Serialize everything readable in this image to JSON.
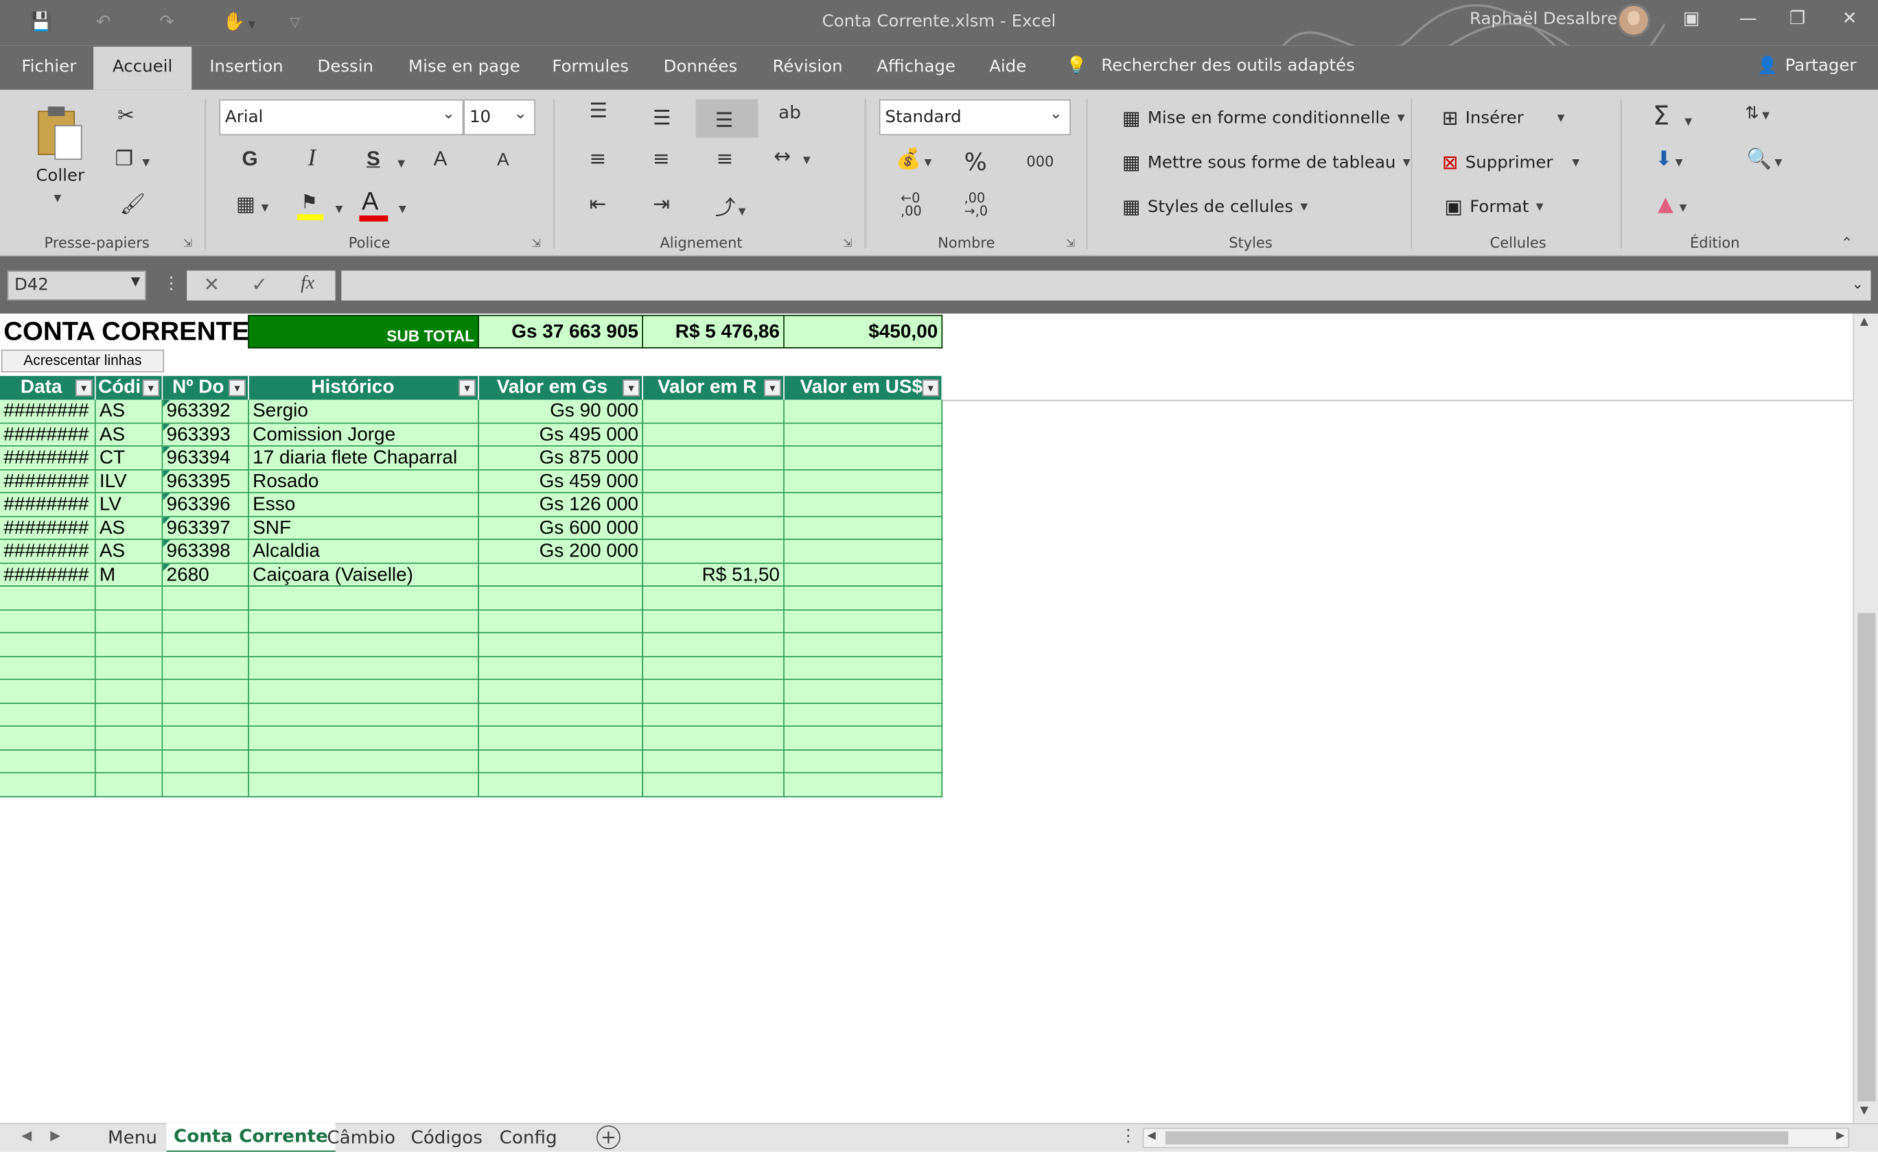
{
  "window": {
    "doc_title": "Conta Corrente.xlsm  -  Excel",
    "user_name": "Raphaël Desalbres"
  },
  "ribbon_tabs": [
    "Fichier",
    "Accueil",
    "Insertion",
    "Dessin",
    "Mise en page",
    "Formules",
    "Données",
    "Révision",
    "Affichage",
    "Aide"
  ],
  "ribbon_search": "Rechercher des outils adaptés",
  "share_label": "Partager",
  "groups": {
    "clipboard": "Presse-papiers",
    "font": "Police",
    "alignment": "Alignement",
    "number": "Nombre",
    "styles": "Styles",
    "cells": "Cellules",
    "editing": "Édition"
  },
  "clipboard": {
    "paste": "Coller"
  },
  "font": {
    "name": "Arial",
    "size": "10",
    "bold": "G",
    "italic": "I",
    "underline": "S",
    "grow": "A",
    "shrink": "A",
    "color": "A"
  },
  "number": {
    "format": "Standard",
    "percent": "%",
    "thousands": "000",
    "inc_dec_top": "←0",
    "inc_dec_bottom": ",00",
    "dec_dec_top": ",00",
    "dec_dec_bottom": "→,0"
  },
  "styles": {
    "conditional": "Mise en forme conditionnelle",
    "as_table": "Mettre sous forme de tableau",
    "cell_styles": "Styles de cellules"
  },
  "cells": {
    "insert": "Insérer",
    "delete": "Supprimer",
    "format": "Format"
  },
  "formula_bar": {
    "name_box": "D42",
    "fx": "fx",
    "value": ""
  },
  "sheet": {
    "title": "CONTA CORRENTE",
    "subtotal_label": "SUB TOTAL",
    "subtotal_gs": "Gs 37 663 905",
    "subtotal_rs": "R$ 5 476,86",
    "subtotal_usd": "$450,00",
    "add_rows_button": "Acrescentar  linhas",
    "headers": [
      "Data",
      "Códi",
      "Nº Do",
      "Histórico",
      "Valor em Gs",
      "Valor em R",
      "Valor em US$"
    ],
    "rows": [
      [
        "########",
        "AS",
        "963392",
        "Sergio",
        "Gs 90 000",
        "",
        ""
      ],
      [
        "########",
        "AS",
        "963393",
        "Comission Jorge",
        "Gs 495 000",
        "",
        ""
      ],
      [
        "########",
        "CT",
        "963394",
        "17 diaria flete Chaparral",
        "Gs 875 000",
        "",
        ""
      ],
      [
        "########",
        "ILV",
        "963395",
        "Rosado",
        "Gs 459 000",
        "",
        ""
      ],
      [
        "########",
        "LV",
        "963396",
        "Esso",
        "Gs 126 000",
        "",
        ""
      ],
      [
        "########",
        "AS",
        "963397",
        "SNF",
        "Gs 600 000",
        "",
        ""
      ],
      [
        "########",
        "AS",
        "963398",
        "Alcaldia",
        "Gs 200 000",
        "",
        ""
      ],
      [
        "########",
        "M",
        "2680",
        "Caiçoara (Vaiselle)",
        "",
        "R$ 51,50",
        ""
      ]
    ],
    "empty_rows": 9
  },
  "sheet_tabs": [
    "Menu",
    "Conta Corrente",
    "Câmbio",
    "Códigos",
    "Config"
  ],
  "active_sheet": "Conta Corrente",
  "colors": {
    "header_green": "#1b8563",
    "row_green": "#ccffcc",
    "title_bar": "#6a6a6a",
    "ribbon": "#d6d6d6"
  }
}
